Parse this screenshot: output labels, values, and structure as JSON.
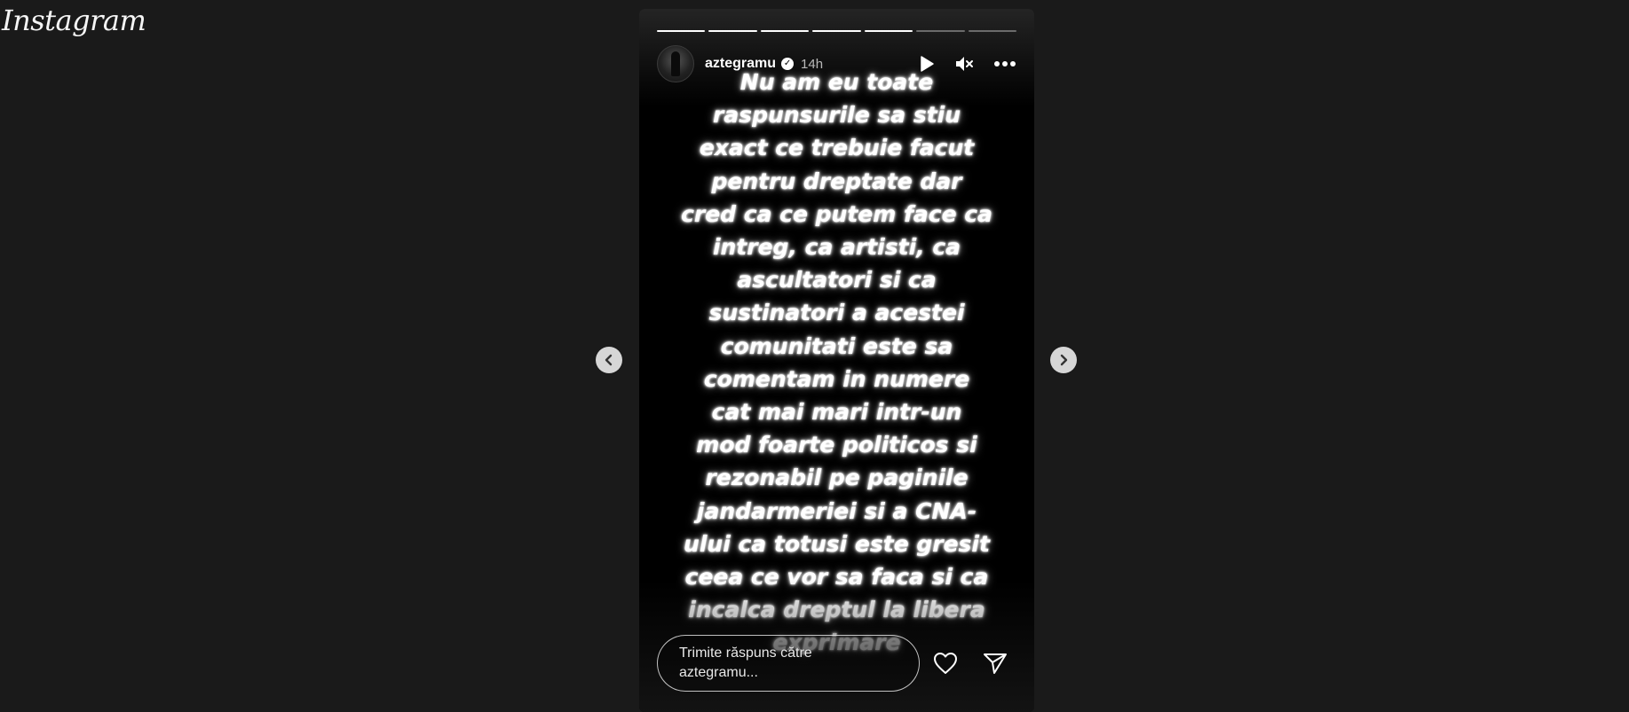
{
  "app": {
    "logo_text": "Instagram"
  },
  "story": {
    "progress": {
      "total_segments": 7,
      "completed_segments": 5
    },
    "author": {
      "username": "aztegramu",
      "verified": true,
      "time_ago": "14h"
    },
    "controls": {
      "play_icon": "play-icon",
      "mute_icon": "muted-speaker-icon",
      "more_icon": "more-options-icon"
    },
    "text_lines": [
      "Nu am eu toate",
      "raspunsurile sa stiu",
      "exact ce trebuie facut",
      "pentru dreptate dar",
      "cred ca ce putem face ca",
      "intreg, ca artisti, ca",
      "ascultatori si ca",
      "sustinatori a acestei",
      "comunitati este sa",
      "comentam in numere",
      "cat mai mari intr-un",
      "mod foarte politicos si",
      "rezonabil pe paginile",
      "jandarmeriei si a CNA-",
      "ului ca totusi este gresit",
      "ceea ce vor sa faca si ca",
      "incalca dreptul la libera",
      "exprimare"
    ],
    "reply": {
      "placeholder_line1": "Trimite răspuns către",
      "placeholder_line2": "aztegramu..."
    }
  },
  "navigation": {
    "prev_icon": "chevron-left-icon",
    "next_icon": "chevron-right-icon"
  },
  "colors": {
    "page_background": "#1a1a1a",
    "story_background": "#000000",
    "text": "#ffffff",
    "nav_button": "#d6d6d6"
  }
}
